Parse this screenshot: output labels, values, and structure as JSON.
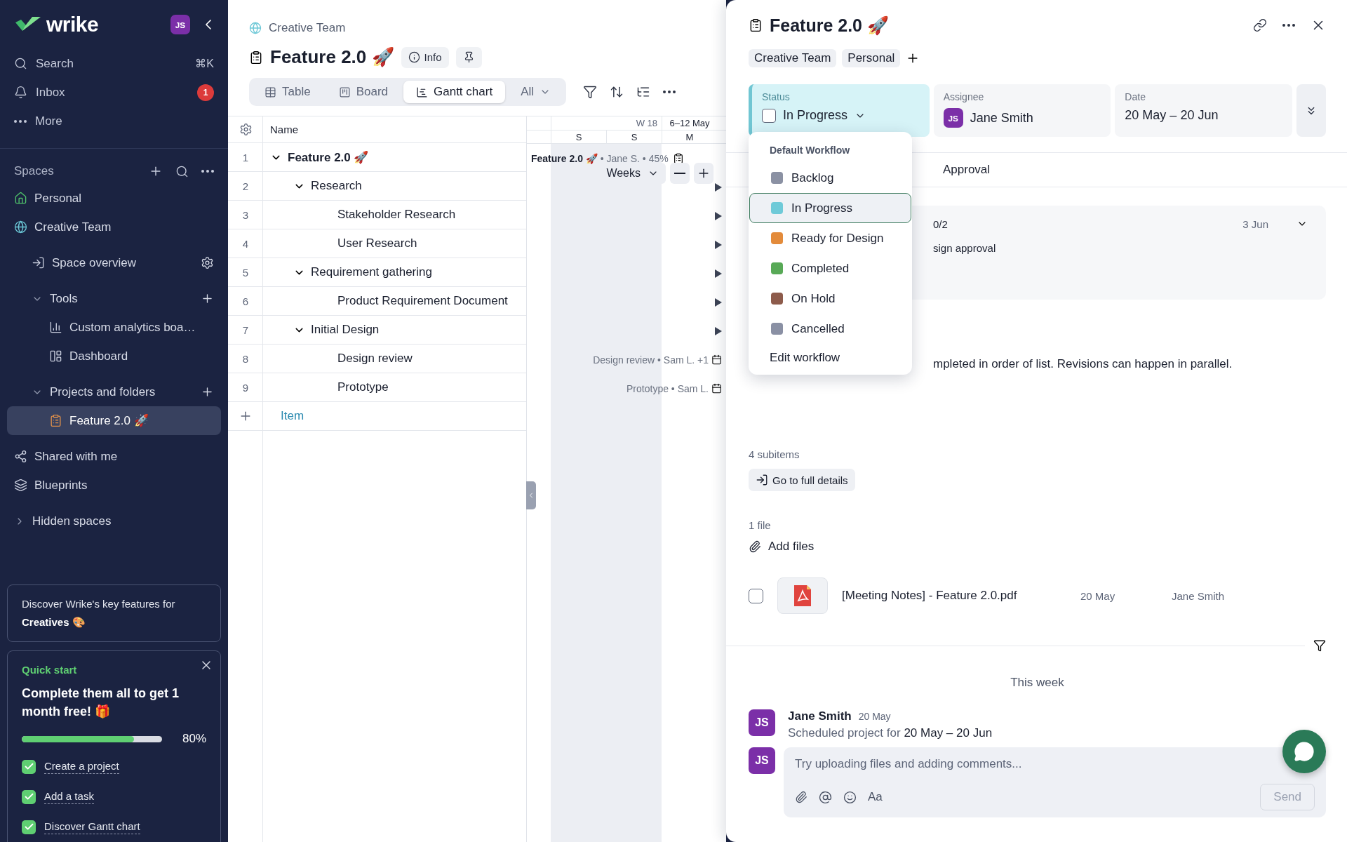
{
  "sidebar": {
    "logo": "wrike",
    "user_avatar": "JS",
    "nav": [
      {
        "label": "Search",
        "shortcut": "⌘K"
      },
      {
        "label": "Inbox",
        "badge": "1"
      },
      {
        "label": "More"
      }
    ],
    "spaces_heading": "Spaces",
    "tree": [
      {
        "label": "Personal",
        "selected": false
      },
      {
        "label": "Creative Team",
        "selected": false,
        "children": [
          {
            "label": "Space overview",
            "selected": false
          },
          {
            "label": "Tools",
            "selected": false,
            "expanded": true,
            "children": [
              {
                "label": "Custom analytics boa…",
                "selected": false
              },
              {
                "label": "Dashboard",
                "selected": false
              }
            ]
          },
          {
            "label": "Projects and folders",
            "selected": false,
            "expanded": true,
            "children": [
              {
                "label": "Feature 2.0 🚀",
                "selected": true
              }
            ]
          }
        ]
      },
      {
        "label": "Shared with me",
        "selected": false
      },
      {
        "label": "Blueprints",
        "selected": false
      },
      {
        "label": "Hidden spaces",
        "selected": false,
        "expanded": false
      }
    ],
    "discover": "Discover Wrike's key features for **Creatives** 🎨",
    "quick_start": {
      "title": "Quick start",
      "heading": "Complete them all to get 1 month free! 🎁",
      "level": 0.8,
      "percent": "80%",
      "tasks": [
        {
          "label": "Create a project",
          "checked": true
        },
        {
          "label": "Add a task",
          "checked": true
        },
        {
          "label": "Discover Gantt chart",
          "checked": true
        }
      ]
    }
  },
  "project": {
    "breadcrumb": "Creative Team",
    "title": "Feature 2.0 🚀",
    "info": "Info",
    "views": [
      {
        "label": "Table",
        "selected": false
      },
      {
        "label": "Board",
        "selected": false
      },
      {
        "label": "Gantt chart",
        "selected": true
      }
    ],
    "filter": "All"
  },
  "table": {
    "name_column": "Name",
    "add_item": "Item",
    "rows": [
      {
        "num": "1",
        "name": "Feature 2.0 🚀",
        "expanded": true,
        "timeline": {
          "kind": "bar_label",
          "text": "**Feature 2.0 🚀** • Jane S. • 45%"
        },
        "children": [
          {
            "num": "2",
            "name": "Research",
            "expanded": true,
            "timeline": {
              "kind": "offscreen"
            },
            "children": [
              {
                "num": "3",
                "name": "Stakeholder Research",
                "timeline": {
                  "kind": "offscreen"
                }
              },
              {
                "num": "4",
                "name": "User Research",
                "timeline": {
                  "kind": "offscreen"
                }
              }
            ]
          },
          {
            "num": "5",
            "name": "Requirement gathering",
            "expanded": true,
            "timeline": {
              "kind": "offscreen"
            },
            "children": [
              {
                "num": "6",
                "name": "Product Requirement Document",
                "timeline": {
                  "kind": "offscreen"
                }
              }
            ]
          },
          {
            "num": "7",
            "name": "Initial Design",
            "expanded": true,
            "timeline": {
              "kind": "offscreen"
            },
            "children": [
              {
                "num": "8",
                "name": "Design review",
                "timeline": {
                  "kind": "label",
                  "text": "Design review • Sam L. +1"
                }
              },
              {
                "num": "9",
                "name": "Prototype",
                "timeline": {
                  "kind": "label",
                  "text": "Prototype • Sam L."
                }
              }
            ]
          }
        ]
      }
    ]
  },
  "gantt": {
    "week": "W 18",
    "range": "6–12 May",
    "days": [
      "S",
      "S",
      "M"
    ],
    "scale": "Weeks"
  },
  "detail": {
    "title": "Feature 2.0 🚀",
    "tags": [
      "Creative Team",
      "Personal"
    ],
    "status": {
      "label": "Status",
      "value": "In Progress",
      "checked": false
    },
    "assignee": {
      "label": "Assignee",
      "avatar": "JS",
      "name": "Jane Smith"
    },
    "date": {
      "label": "Date",
      "value": "20 May – 20 Jun"
    },
    "status_menu": {
      "heading": "Default Workflow",
      "footer": "Edit workflow",
      "options": [
        {
          "label": "Backlog",
          "color": "#8b91a3",
          "selected": false
        },
        {
          "label": "In Progress",
          "color": "#6fcad8",
          "selected": true
        },
        {
          "label": "Ready for Design",
          "color": "#e38b3b",
          "selected": false
        },
        {
          "label": "Completed",
          "color": "#58a957",
          "selected": false
        },
        {
          "label": "On Hold",
          "color": "#8d5b4b",
          "selected": false
        },
        {
          "label": "Cancelled",
          "color": "#8a90a4",
          "selected": false
        }
      ]
    },
    "approval": "Approval",
    "approval_card": {
      "count": "0/2",
      "date": "3 Jun",
      "text": "sign approval"
    },
    "description": "mpleted in order of list. Revisions can happen in parallel.",
    "subitems": "4 subitems",
    "full_details": "Go to full details",
    "files": {
      "count": "1 file",
      "add": "Add files",
      "items": [
        {
          "name": "[Meeting Notes] - Feature 2.0.pdf",
          "date": "20 May",
          "owner": "Jane Smith",
          "checked": false
        }
      ]
    },
    "activity": {
      "heading": "This week",
      "entries": [
        {
          "avatar": "JS",
          "author": "Jane Smith",
          "date": "20 May",
          "text": "Scheduled project for **20 May – 20 Jun**"
        }
      ]
    },
    "comment": {
      "avatar": "JS",
      "placeholder": "Try uploading files and adding comments...",
      "format": "Aa",
      "send": {
        "label": "Send",
        "disabled": true
      }
    }
  }
}
